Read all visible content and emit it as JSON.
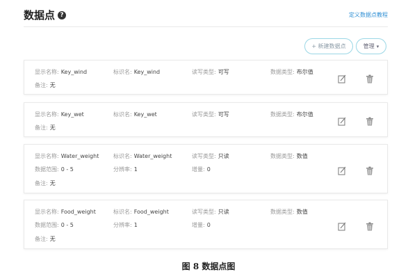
{
  "header": {
    "title": "数据点",
    "help_glyph": "?",
    "doc_link": "定义数据点教程"
  },
  "toolbar": {
    "new_label": "+ 新建数据点",
    "manage_label": "管理",
    "manage_caret": "▾"
  },
  "cards": [
    {
      "rows": [
        [
          {
            "label": "显示名称:",
            "value": "Key_wind"
          },
          {
            "label": "标识名:",
            "value": "Key_wind"
          },
          {
            "label": "读写类型:",
            "value": "可写"
          },
          {
            "label": "数据类型:",
            "value": "布尔值"
          }
        ],
        [
          {
            "label": "备注:",
            "value": "无"
          }
        ]
      ]
    },
    {
      "rows": [
        [
          {
            "label": "显示名称:",
            "value": "Key_wet"
          },
          {
            "label": "标识名:",
            "value": "Key_wet"
          },
          {
            "label": "读写类型:",
            "value": "可写"
          },
          {
            "label": "数据类型:",
            "value": "布尔值"
          }
        ],
        [
          {
            "label": "备注:",
            "value": "无"
          }
        ]
      ]
    },
    {
      "rows": [
        [
          {
            "label": "显示名称:",
            "value": "Water_weight"
          },
          {
            "label": "标识名:",
            "value": "Water_weight"
          },
          {
            "label": "读写类型:",
            "value": "只读"
          },
          {
            "label": "数据类型:",
            "value": "数值"
          }
        ],
        [
          {
            "label": "数据范围:",
            "value": "0 - 5"
          },
          {
            "label": "分辨率:",
            "value": "1"
          },
          {
            "label": "增量:",
            "value": "0"
          }
        ],
        [
          {
            "label": "备注:",
            "value": "无"
          }
        ]
      ]
    },
    {
      "rows": [
        [
          {
            "label": "显示名称:",
            "value": "Food_weight"
          },
          {
            "label": "标识名:",
            "value": "Food_weight"
          },
          {
            "label": "读写类型:",
            "value": "只读"
          },
          {
            "label": "数据类型:",
            "value": "数值"
          }
        ],
        [
          {
            "label": "数据范围:",
            "value": "0 - 5"
          },
          {
            "label": "分辨率:",
            "value": "1"
          },
          {
            "label": "增量:",
            "value": "0"
          }
        ],
        [
          {
            "label": "备注:",
            "value": "无"
          }
        ]
      ]
    }
  ],
  "caption": "图 8   数据点图"
}
